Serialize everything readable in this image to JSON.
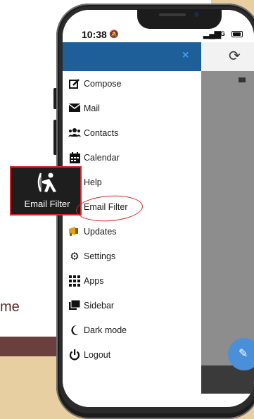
{
  "slide": {
    "partial_text": "me"
  },
  "status_bar": {
    "time": "10:38",
    "network": "5G"
  },
  "drawer": {
    "close_label": "×",
    "items": [
      {
        "label": "Compose",
        "icon": "compose-icon"
      },
      {
        "label": "Mail",
        "icon": "envelope-icon"
      },
      {
        "label": "Contacts",
        "icon": "contacts-icon"
      },
      {
        "label": "Calendar",
        "icon": "calendar-icon"
      },
      {
        "label": "Help",
        "icon": "help-icon"
      },
      {
        "label": "Email Filter",
        "icon": "email-filter-icon"
      },
      {
        "label": "Updates",
        "icon": "megaphone-icon"
      },
      {
        "label": "Settings",
        "icon": "gear-icon"
      },
      {
        "label": "Apps",
        "icon": "apps-grid-icon"
      },
      {
        "label": "Sidebar",
        "icon": "sidebar-icon"
      },
      {
        "label": "Dark mode",
        "icon": "moon-icon"
      },
      {
        "label": "Logout",
        "icon": "power-icon"
      }
    ]
  },
  "callout": {
    "label": "Email Filter"
  },
  "colors": {
    "drawer_header": "#1f5f99",
    "close_icon": "#3fa0ff",
    "highlight": "#d7262c",
    "background": "#e7cfa2",
    "slide_bar": "#6b3f3e",
    "fab": "#4a90d9"
  }
}
